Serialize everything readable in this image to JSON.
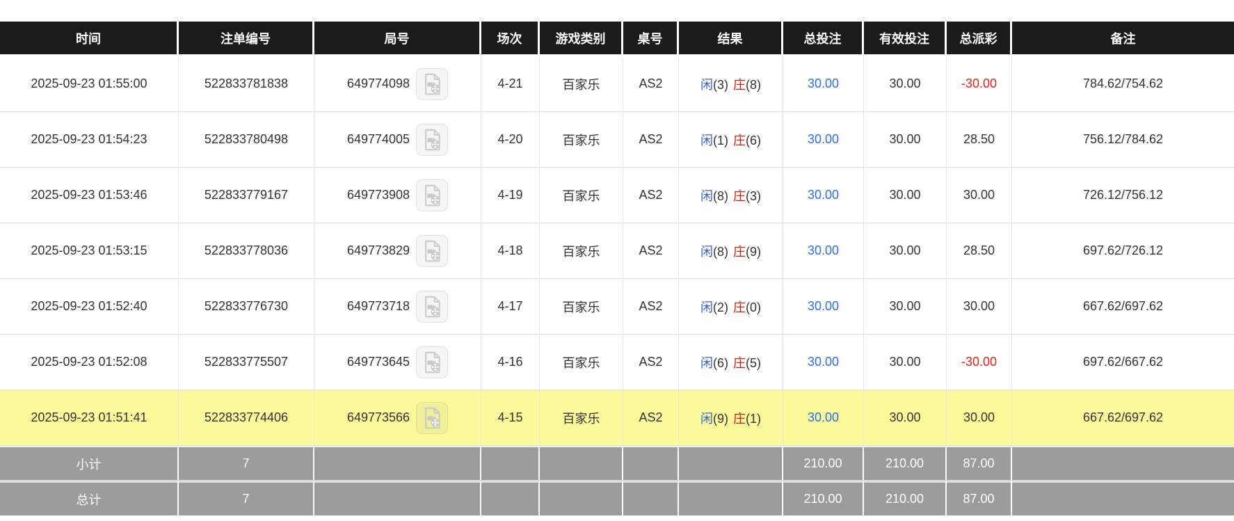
{
  "colors": {
    "header_bg": "#1b1b1b",
    "header_text": "#ffffff",
    "body_text": "#333333",
    "total_bet_blue": "#2a6ee8",
    "negative_red": "#e02417",
    "player_blue": "#3460d8",
    "banker_red": "#cc2017",
    "highlight_row_bg": "#fafa9b",
    "summary_bg": "#9c9c9c",
    "summary_text": "#ffffff"
  },
  "icons": {
    "video_replay": "video-file-icon"
  },
  "table": {
    "columns": [
      {
        "id": "time",
        "label": "时间"
      },
      {
        "id": "order_id",
        "label": "注单编号"
      },
      {
        "id": "round_id",
        "label": "局号"
      },
      {
        "id": "session",
        "label": "场次"
      },
      {
        "id": "game_type",
        "label": "游戏类别"
      },
      {
        "id": "table_no",
        "label": "桌号"
      },
      {
        "id": "result",
        "label": "结果"
      },
      {
        "id": "total_bet",
        "label": "总投注"
      },
      {
        "id": "valid_bet",
        "label": "有效投注"
      },
      {
        "id": "payout",
        "label": "总派彩"
      },
      {
        "id": "note",
        "label": "备注"
      }
    ],
    "rows": [
      {
        "time": "2025-09-23 01:55:00",
        "order_id": "522833781838",
        "round_id": "649774098",
        "session": "4-21",
        "game_type": "百家乐",
        "table_no": "AS2",
        "result": {
          "player_label": "闲",
          "player_value": "(3)",
          "banker_label": "庄",
          "banker_value": "(8)"
        },
        "total_bet": "30.00",
        "valid_bet": "30.00",
        "payout": "-30.00",
        "payout_negative": true,
        "note": "784.62/754.62",
        "highlighted": false
      },
      {
        "time": "2025-09-23 01:54:23",
        "order_id": "522833780498",
        "round_id": "649774005",
        "session": "4-20",
        "game_type": "百家乐",
        "table_no": "AS2",
        "result": {
          "player_label": "闲",
          "player_value": "(1)",
          "banker_label": "庄",
          "banker_value": "(6)"
        },
        "total_bet": "30.00",
        "valid_bet": "30.00",
        "payout": "28.50",
        "payout_negative": false,
        "note": "756.12/784.62",
        "highlighted": false
      },
      {
        "time": "2025-09-23 01:53:46",
        "order_id": "522833779167",
        "round_id": "649773908",
        "session": "4-19",
        "game_type": "百家乐",
        "table_no": "AS2",
        "result": {
          "player_label": "闲",
          "player_value": "(8)",
          "banker_label": "庄",
          "banker_value": "(3)"
        },
        "total_bet": "30.00",
        "valid_bet": "30.00",
        "payout": "30.00",
        "payout_negative": false,
        "note": "726.12/756.12",
        "highlighted": false
      },
      {
        "time": "2025-09-23 01:53:15",
        "order_id": "522833778036",
        "round_id": "649773829",
        "session": "4-18",
        "game_type": "百家乐",
        "table_no": "AS2",
        "result": {
          "player_label": "闲",
          "player_value": "(8)",
          "banker_label": "庄",
          "banker_value": "(9)"
        },
        "total_bet": "30.00",
        "valid_bet": "30.00",
        "payout": "28.50",
        "payout_negative": false,
        "note": "697.62/726.12",
        "highlighted": false
      },
      {
        "time": "2025-09-23 01:52:40",
        "order_id": "522833776730",
        "round_id": "649773718",
        "session": "4-17",
        "game_type": "百家乐",
        "table_no": "AS2",
        "result": {
          "player_label": "闲",
          "player_value": "(2)",
          "banker_label": "庄",
          "banker_value": "(0)"
        },
        "total_bet": "30.00",
        "valid_bet": "30.00",
        "payout": "30.00",
        "payout_negative": false,
        "note": "667.62/697.62",
        "highlighted": false
      },
      {
        "time": "2025-09-23 01:52:08",
        "order_id": "522833775507",
        "round_id": "649773645",
        "session": "4-16",
        "game_type": "百家乐",
        "table_no": "AS2",
        "result": {
          "player_label": "闲",
          "player_value": "(6)",
          "banker_label": "庄",
          "banker_value": "(5)"
        },
        "total_bet": "30.00",
        "valid_bet": "30.00",
        "payout": "-30.00",
        "payout_negative": true,
        "note": "697.62/667.62",
        "highlighted": false
      },
      {
        "time": "2025-09-23 01:51:41",
        "order_id": "522833774406",
        "round_id": "649773566",
        "session": "4-15",
        "game_type": "百家乐",
        "table_no": "AS2",
        "result": {
          "player_label": "闲",
          "player_value": "(9)",
          "banker_label": "庄",
          "banker_value": "(1)"
        },
        "total_bet": "30.00",
        "valid_bet": "30.00",
        "payout": "30.00",
        "payout_negative": false,
        "note": "667.62/697.62",
        "highlighted": true
      }
    ],
    "summary_rows": [
      {
        "label": "小计",
        "count": "7",
        "total_bet": "210.00",
        "valid_bet": "210.00",
        "payout": "87.00"
      },
      {
        "label": "总计",
        "count": "7",
        "total_bet": "210.00",
        "valid_bet": "210.00",
        "payout": "87.00"
      }
    ]
  }
}
